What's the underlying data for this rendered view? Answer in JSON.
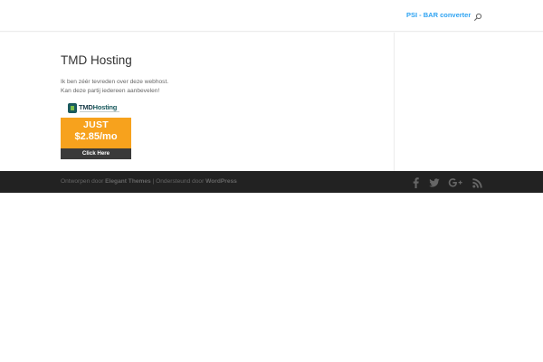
{
  "header": {
    "nav_link": "PSI - BAR converter",
    "search_icon": "search-icon"
  },
  "main": {
    "title": "TMD Hosting",
    "text_line_1": "Ik ben zéér tevreden over deze webhost.",
    "text_line_2": "Kan deze partij iedereen aanbevelen!"
  },
  "banner": {
    "logo_tmd": "TMD",
    "logo_hosting": "Hosting",
    "just": "JUST",
    "price": "$2.85/mo",
    "cta": "Click Here"
  },
  "footer": {
    "designed_by": "Ontworpen door",
    "theme_link": "Elegant Themes",
    "separator": "|",
    "powered_by": "Ondersteund door",
    "wp_link": "WordPress",
    "social_icons": [
      "facebook-icon",
      "twitter-icon",
      "google-plus-icon",
      "rss-icon"
    ]
  },
  "colors": {
    "accent": "#2ea3f2",
    "footer_bg": "#222222",
    "banner_orange": "#f7a21d"
  }
}
